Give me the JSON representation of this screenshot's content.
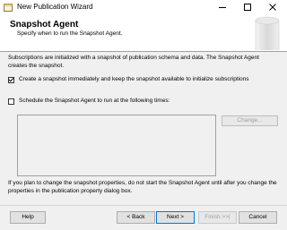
{
  "window": {
    "title": "New Publication Wizard",
    "icon": "wizard-icon"
  },
  "title_bar_buttons": {
    "minimize_icon": "minimize-icon",
    "maximize_icon": "maximize-icon",
    "close_icon": "close-icon"
  },
  "header": {
    "title": "Snapshot Agent",
    "subtitle": "Specify when to run the Snapshot Agent.",
    "graphic": "database-cylinder-graphic"
  },
  "main": {
    "intro": "Subscriptions are initialized with a snapshot of publication schema and data. The Snapshot Agent creates the snapshot.",
    "options": [
      {
        "label": "Create a snapshot immediately and keep the snapshot available to initialize subscriptions",
        "checked": true
      },
      {
        "label": "Schedule the Snapshot Agent to run at the following times:",
        "checked": false
      }
    ],
    "schedule_text": "",
    "change_label": "Change...",
    "note": "If you plan to change the snapshot properties, do not start the Snapshot Agent until after you change the properties in the publication property dialog box."
  },
  "footer": {
    "help_label": "Help",
    "back_label": "< Back",
    "next_label": "Next >",
    "finish_label": "Finish >>|",
    "cancel_label": "Cancel"
  },
  "colors": {
    "accent_border": "#0078d7",
    "panel_background": "#f0f0f0",
    "disabled_text": "#a0a0a0"
  }
}
